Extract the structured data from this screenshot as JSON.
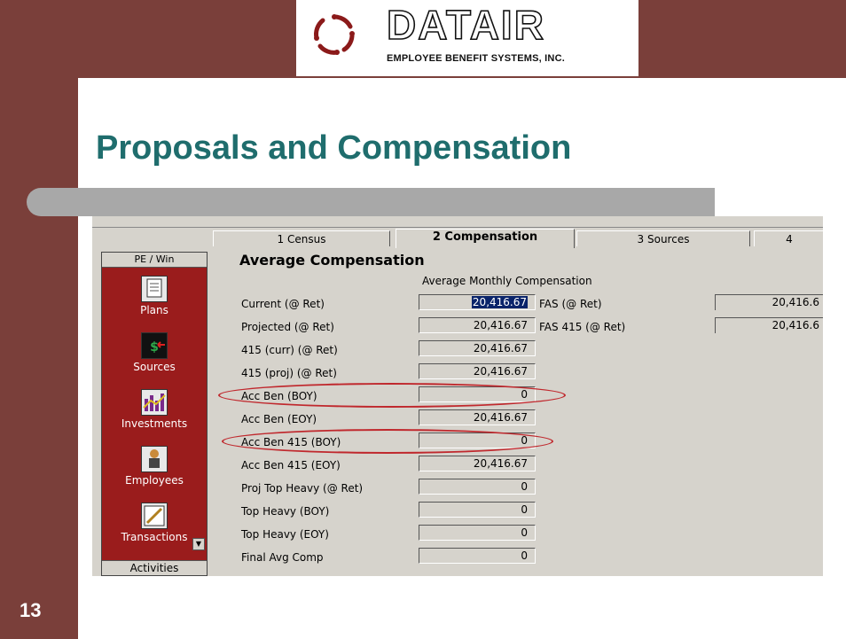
{
  "slide": {
    "title": "Proposals and Compensation",
    "number": "13"
  },
  "logo": {
    "wordmark": "DATAIR",
    "subtitle": "EMPLOYEE BENEFIT SYSTEMS, INC."
  },
  "tabs": [
    {
      "label": "1 Census",
      "active": false
    },
    {
      "label": "2 Compensation",
      "active": true
    },
    {
      "label": "3 Sources",
      "active": false
    },
    {
      "label": "4",
      "active": false
    }
  ],
  "sidebar": {
    "header": "PE / Win",
    "items": [
      {
        "label": "Plans",
        "icon": "plans-icon"
      },
      {
        "label": "Sources",
        "icon": "contrib-sources-icon"
      },
      {
        "label": "Investments",
        "icon": "invest-icon"
      },
      {
        "label": "Employees",
        "icon": "employee-icon"
      },
      {
        "label": "Transactions",
        "icon": "transactions-icon"
      }
    ],
    "footer": "Activities"
  },
  "section": {
    "title": "Average Compensation",
    "column_caption": "Average Monthly Compensation"
  },
  "rows": [
    {
      "label": "Current (@ Ret)",
      "value": "20,416.67",
      "selected": true
    },
    {
      "label": "Projected (@ Ret)",
      "value": "20,416.67"
    },
    {
      "label": "415 (curr) (@ Ret)",
      "value": "20,416.67"
    },
    {
      "label": "415 (proj) (@ Ret)",
      "value": "20,416.67"
    },
    {
      "label": "Acc Ben (BOY)",
      "value": "0",
      "highlighted": true
    },
    {
      "label": "Acc Ben (EOY)",
      "value": "20,416.67"
    },
    {
      "label": "Acc Ben 415 (BOY)",
      "value": "0",
      "highlighted": true
    },
    {
      "label": "Acc Ben 415 (EOY)",
      "value": "20,416.67"
    },
    {
      "label": "Proj Top Heavy (@ Ret)",
      "value": "0"
    },
    {
      "label": "Top Heavy (BOY)",
      "value": "0"
    },
    {
      "label": "Top Heavy (EOY)",
      "value": "0"
    },
    {
      "label": "Final Avg Comp",
      "value": "0"
    }
  ],
  "fas": [
    {
      "label": "FAS (@ Ret)",
      "value": "20,416.6"
    },
    {
      "label": "FAS 415 (@ Ret)",
      "value": "20,416.6"
    }
  ],
  "colors": {
    "frame": "#7a3f3a",
    "title": "#1f6d6d",
    "sidebar": "#9a1c1c",
    "highlight": "#c0282d",
    "selection": "#0a246a"
  }
}
